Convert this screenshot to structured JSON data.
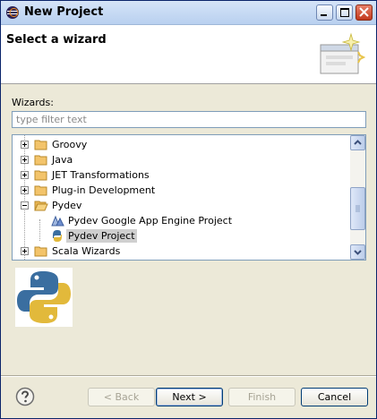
{
  "window": {
    "title": "New Project",
    "app_icon": "eclipse-icon",
    "controls": {
      "minimize": "minimize-icon",
      "maximize": "maximize-icon",
      "close": "close-icon"
    }
  },
  "banner": {
    "heading": "Select a wizard",
    "image": "wizard-banner-icon"
  },
  "wizards": {
    "label": "Wizards:",
    "filter_placeholder": "type filter text",
    "filter_value": "",
    "tree": [
      {
        "label": "Groovy",
        "expander": "plus",
        "icon": "folder-icon"
      },
      {
        "label": "Java",
        "expander": "plus",
        "icon": "folder-icon"
      },
      {
        "label": "JET Transformations",
        "expander": "plus",
        "icon": "folder-icon"
      },
      {
        "label": "Plug-in Development",
        "expander": "plus",
        "icon": "folder-icon"
      },
      {
        "label": "Pydev",
        "expander": "minus",
        "icon": "folder-open-icon"
      },
      {
        "label": "Pydev Google App Engine Project",
        "icon": "google-app-engine-icon",
        "child": true
      },
      {
        "label": "Pydev Project",
        "icon": "python-icon",
        "child": true,
        "selected": true
      },
      {
        "label": "Scala Wizards",
        "expander": "plus",
        "icon": "folder-icon"
      }
    ]
  },
  "preview_image": "python-logo",
  "buttons": {
    "help": "help-icon",
    "back": "< Back",
    "next": "Next >",
    "finish": "Finish",
    "cancel": "Cancel"
  },
  "colors": {
    "python_blue": "#3a6ea0",
    "python_yellow": "#e2b93b",
    "selection": "#cfcfcf"
  }
}
